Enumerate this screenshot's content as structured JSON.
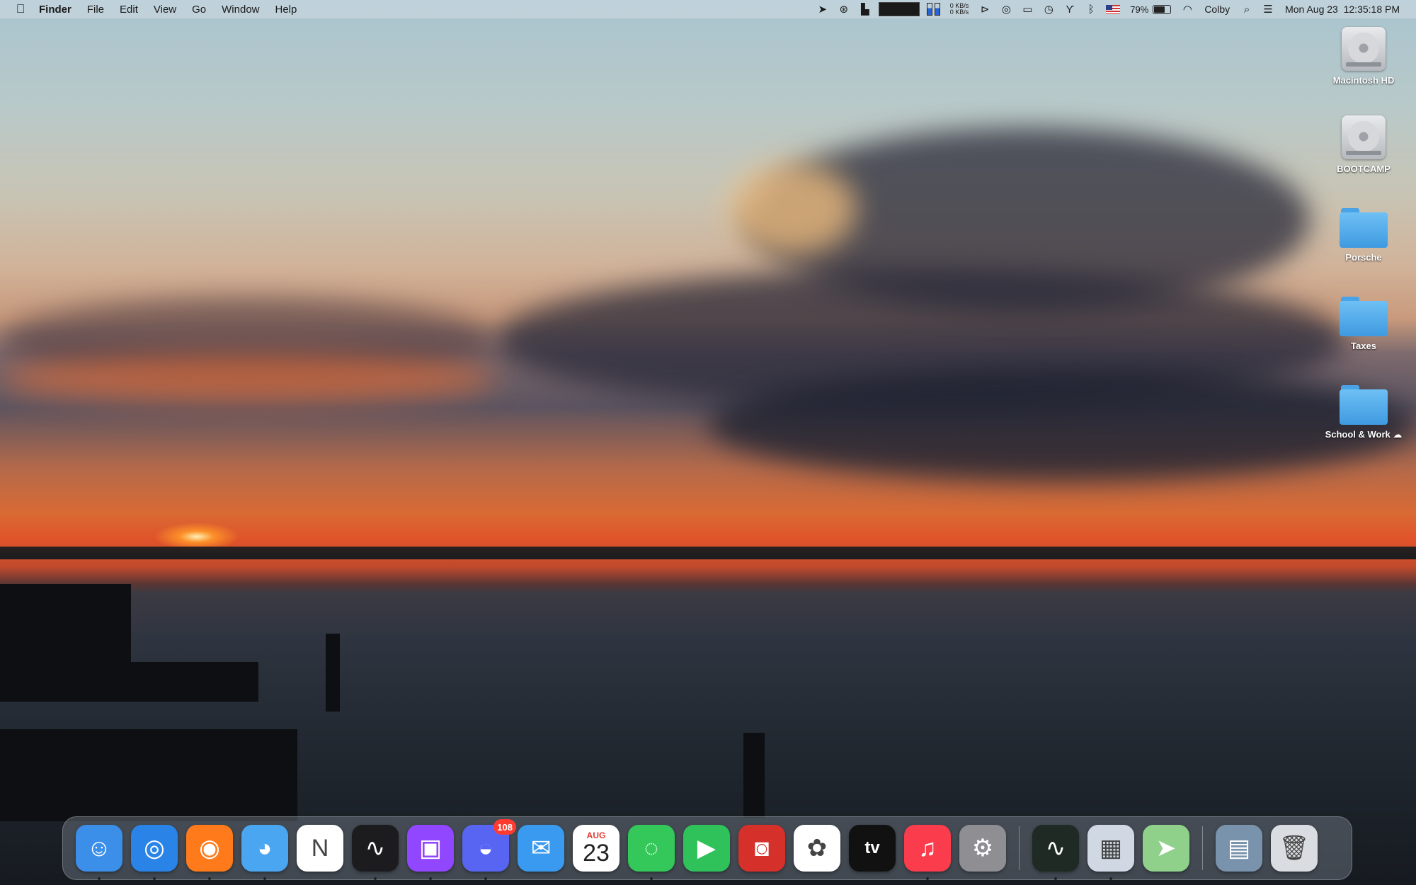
{
  "menubar": {
    "apple_icon": "apple-logo-icon",
    "app_name": "Finder",
    "menus": [
      "File",
      "Edit",
      "View",
      "Go",
      "Window",
      "Help"
    ],
    "net_up": "0 KB/s",
    "net_down": "0 KB/s",
    "battery_percent": "79%",
    "battery_level": 0.79,
    "user_name": "Colby",
    "datetime": "Mon Aug 23  12:35:18 PM"
  },
  "desktop": {
    "items": [
      {
        "label": "Macintosh HD",
        "kind": "disk"
      },
      {
        "label": "BOOTCAMP",
        "kind": "disk"
      },
      {
        "label": "Porsche",
        "kind": "folder"
      },
      {
        "label": "Taxes",
        "kind": "folder"
      },
      {
        "label": "School & Work",
        "kind": "folder",
        "extra_icon": "icloud-upload-icon"
      }
    ]
  },
  "dock": {
    "apps": [
      {
        "name": "Finder",
        "icon": "finder-icon",
        "color": "#3b8fe8",
        "glyph": "☺",
        "running": true
      },
      {
        "name": "Safari",
        "icon": "safari-icon",
        "color": "#2a84e8",
        "glyph": "◎",
        "running": true
      },
      {
        "name": "Firefox",
        "icon": "firefox-icon",
        "color": "#ff7a1a",
        "glyph": "◉",
        "running": true
      },
      {
        "name": "Tweetbot",
        "icon": "tweetbot-icon",
        "color": "#4aa6f0",
        "glyph": "◕",
        "running": true
      },
      {
        "name": "News",
        "icon": "news-icon",
        "color": "#ffffff",
        "glyph": "N",
        "running": false
      },
      {
        "name": "Stocks",
        "icon": "stocks-icon",
        "color": "#1c1c1e",
        "glyph": "∿",
        "running": true
      },
      {
        "name": "Twitch",
        "icon": "twitch-icon",
        "color": "#9146ff",
        "glyph": "▣",
        "running": true
      },
      {
        "name": "Discord",
        "icon": "discord-icon",
        "color": "#5865f2",
        "glyph": "◒",
        "running": true,
        "badge": "108"
      },
      {
        "name": "Mail",
        "icon": "mail-icon",
        "color": "#3a9af0",
        "glyph": "✉",
        "running": false
      },
      {
        "name": "Calendar",
        "icon": "calendar-icon",
        "color": "#ffffff",
        "running": false,
        "month": "AUG",
        "day": "23"
      },
      {
        "name": "Messages",
        "icon": "messages-icon",
        "color": "#34c759",
        "glyph": "◌",
        "running": true
      },
      {
        "name": "FaceTime",
        "icon": "facetime-icon",
        "color": "#30c25a",
        "glyph": "▶",
        "running": false
      },
      {
        "name": "Photo Booth",
        "icon": "photo-booth-icon",
        "color": "#d6302a",
        "glyph": "◙",
        "running": false
      },
      {
        "name": "Photos",
        "icon": "photos-icon",
        "color": "#ffffff",
        "glyph": "✿",
        "running": false
      },
      {
        "name": "TV",
        "icon": "apple-tv-icon",
        "color": "#111111",
        "glyph": "tv",
        "running": false
      },
      {
        "name": "Music",
        "icon": "music-icon",
        "color": "#fa3c4c",
        "glyph": "♫",
        "running": true
      },
      {
        "name": "System Preferences",
        "icon": "system-preferences-icon",
        "color": "#8e8e93",
        "glyph": "⚙",
        "running": false
      },
      {
        "name": "Activity Monitor",
        "icon": "activity-monitor-icon",
        "color": "#1f2a24",
        "glyph": "∿",
        "running": true,
        "separator_before": true
      },
      {
        "name": "Preview",
        "icon": "preview-icon",
        "color": "#cfd8e3",
        "glyph": "▦",
        "running": true
      },
      {
        "name": "Maps",
        "icon": "maps-icon",
        "color": "#8fd18a",
        "glyph": "➤",
        "running": false
      },
      {
        "name": "Downloads Stack",
        "icon": "downloads-stack-icon",
        "color": "#7a93ad",
        "glyph": "▤",
        "running": false,
        "separator_before": true
      },
      {
        "name": "Trash",
        "icon": "trash-icon",
        "color": "#d9dce0",
        "glyph": "🗑",
        "running": false
      }
    ]
  }
}
